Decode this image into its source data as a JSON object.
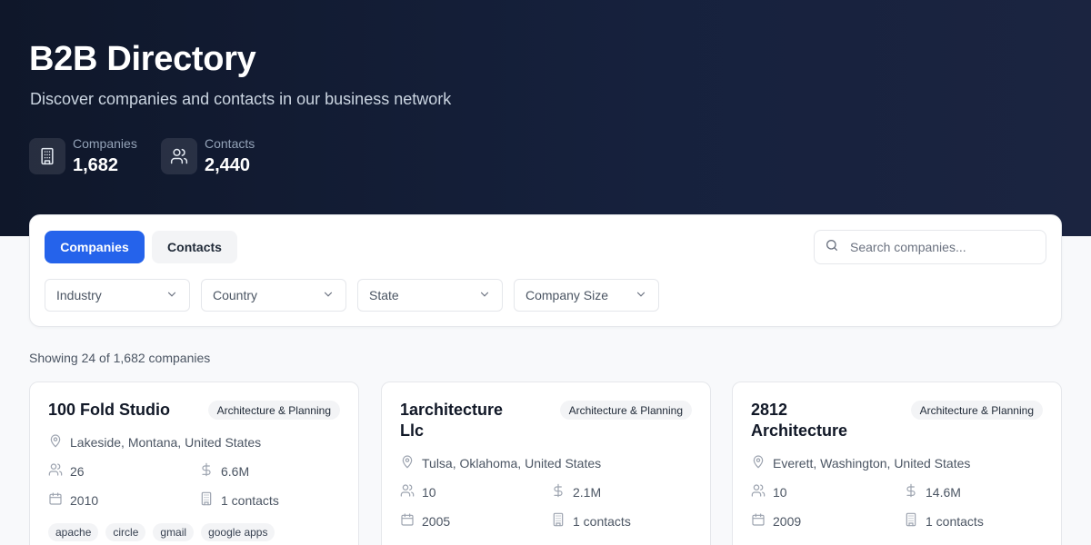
{
  "header": {
    "title": "B2B Directory",
    "subtitle": "Discover companies and contacts in our business network",
    "stats": [
      {
        "label": "Companies",
        "value": "1,682",
        "icon": "building-icon"
      },
      {
        "label": "Contacts",
        "value": "2,440",
        "icon": "users-icon"
      }
    ]
  },
  "panel": {
    "tabs": [
      {
        "label": "Companies",
        "active": true
      },
      {
        "label": "Contacts",
        "active": false
      }
    ],
    "search": {
      "placeholder": "Search companies...",
      "value": ""
    },
    "filters": [
      "Industry",
      "Country",
      "State",
      "Company Size"
    ]
  },
  "results": {
    "summary": "Showing 24 of 1,682 companies"
  },
  "companies": [
    {
      "name": "100 Fold Studio",
      "industry": "Architecture & Planning",
      "location": "Lakeside, Montana, United States",
      "employees": "26",
      "revenue": "6.6M",
      "founded": "2010",
      "contacts": "1 contacts",
      "tags": [
        "apache",
        "circle",
        "gmail",
        "google apps"
      ]
    },
    {
      "name": "1architecture Llc",
      "name_lines": [
        "1architecture",
        "Llc"
      ],
      "industry": "Architecture & Planning",
      "location": "Tulsa, Oklahoma, United States",
      "employees": "10",
      "revenue": "2.1M",
      "founded": "2005",
      "contacts": "1 contacts",
      "tags": []
    },
    {
      "name": "2812 Architecture",
      "name_lines": [
        "2812",
        "Architecture"
      ],
      "industry": "Architecture & Planning",
      "location": "Everett, Washington, United States",
      "employees": "10",
      "revenue": "14.6M",
      "founded": "2009",
      "contacts": "1 contacts",
      "tags": []
    }
  ],
  "colors": {
    "accent": "#2563eb",
    "hero": "#0f172a"
  }
}
